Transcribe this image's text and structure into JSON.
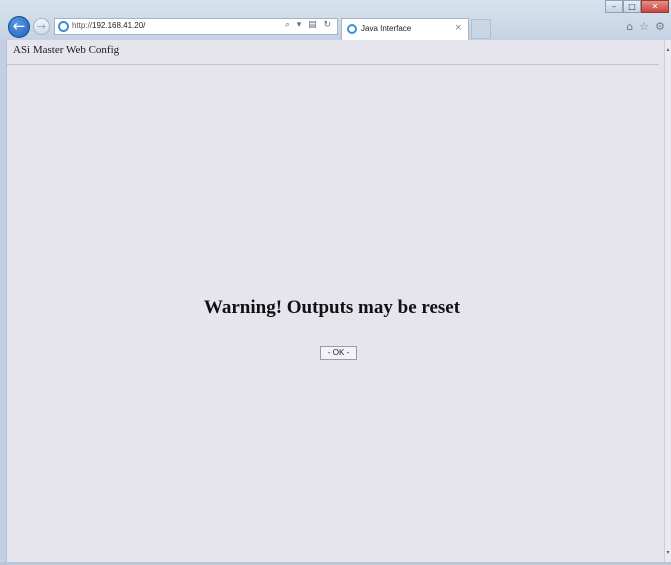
{
  "browser": {
    "url_prefix": "http://",
    "url_host": "192.168.41.20/",
    "address_tools": "⌕ ▾ ▤ ↻",
    "tab_title": "Java Interface",
    "tab_close": "×",
    "back_glyph": "←",
    "forward_glyph": "→",
    "window_controls": {
      "minimize": "–",
      "maximize": "□",
      "close": "✕"
    },
    "toolbar_icons": {
      "home": "⌂",
      "favorites": "☆",
      "settings": "⚙"
    }
  },
  "page": {
    "header": "ASi Master Web Config",
    "warning": "Warning! Outputs may be reset",
    "ok_button": "- OK -"
  },
  "scrollbar": {
    "up": "▴",
    "down": "▾"
  }
}
